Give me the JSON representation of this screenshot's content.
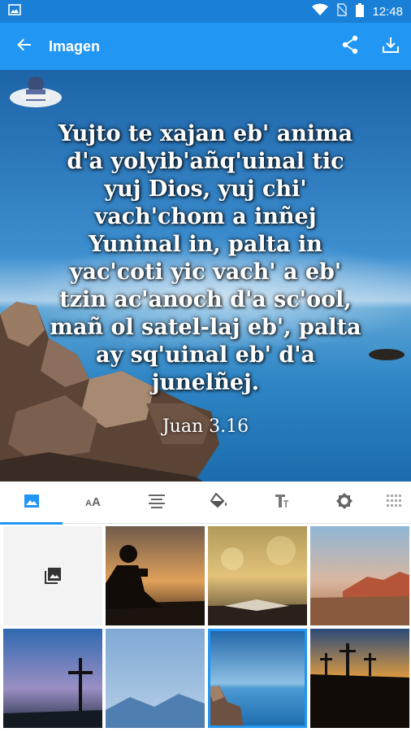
{
  "status_bar": {
    "time": "12:48",
    "icons": [
      "image-notification-icon",
      "wifi-icon",
      "no-sim-icon",
      "battery-icon"
    ]
  },
  "app_bar": {
    "title": "Imagen",
    "back_icon": "arrow-back-icon",
    "actions": [
      "share-icon",
      "download-icon"
    ]
  },
  "preview": {
    "verse_text": "Yujto te xajan eb' anima\nd'a yolyib'añq'uinal tic\nyuj Dios, yuj chi'\nvach'chom a inñej\nYuninal in, palta in\nyac'coti yic vach' a eb'\ntzin ac'anoch d'a sc'ool,\nmañ ol satel-laj eb', palta\nay sq'uinal eb' d'a\njunelñej.",
    "reference": "Juan 3.16",
    "text_color": "#ffffff"
  },
  "tabs": [
    {
      "name": "tab-backgrounds",
      "icon": "image-icon",
      "active": true
    },
    {
      "name": "tab-font",
      "icon": "font-size-icon",
      "active": false
    },
    {
      "name": "tab-alignment",
      "icon": "align-center-icon",
      "active": false
    },
    {
      "name": "tab-color",
      "icon": "paint-bucket-icon",
      "active": false
    },
    {
      "name": "tab-text-style",
      "icon": "text-format-icon",
      "active": false
    },
    {
      "name": "tab-adjust",
      "icon": "brightness-icon",
      "active": false
    },
    {
      "name": "tab-more",
      "icon": "grid-dots-icon",
      "active": false
    }
  ],
  "gallery": {
    "items": [
      {
        "name": "gallery-picker",
        "icon": "photo-library-icon"
      },
      {
        "name": "bg-boy-reading-sunset"
      },
      {
        "name": "bg-open-bible-bokeh"
      },
      {
        "name": "bg-desert-mountains"
      },
      {
        "name": "bg-cross-twilight"
      },
      {
        "name": "bg-misty-mountains"
      },
      {
        "name": "bg-rocky-sea",
        "selected": true
      },
      {
        "name": "bg-three-crosses-sunset"
      }
    ]
  },
  "colors": {
    "accent": "#2196f3",
    "status_bar": "#1a7fd6"
  }
}
